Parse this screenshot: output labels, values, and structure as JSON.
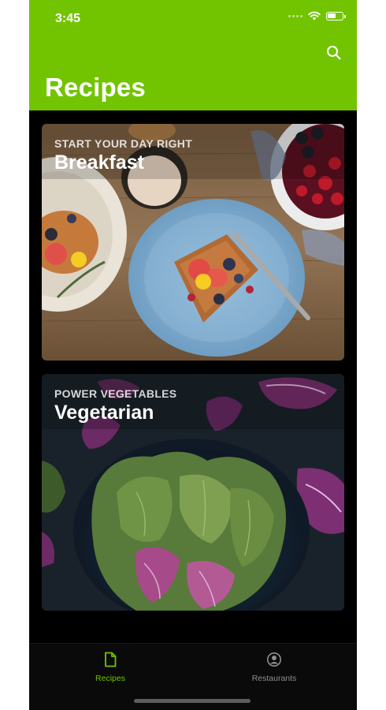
{
  "status": {
    "time": "3:45"
  },
  "header": {
    "title": "Recipes",
    "search_icon": "search-icon"
  },
  "cards": [
    {
      "subtitle": "START YOUR DAY RIGHT",
      "title": "Breakfast"
    },
    {
      "subtitle": "POWER VEGETABLES",
      "title": "Vegetarian"
    }
  ],
  "tabs": [
    {
      "label": "Recipes",
      "icon": "document-icon",
      "active": true
    },
    {
      "label": "Restaurants",
      "icon": "person-circle-icon",
      "active": false
    }
  ],
  "colors": {
    "accent": "#73c400",
    "background": "#000000",
    "inactive": "#8e8e93"
  }
}
